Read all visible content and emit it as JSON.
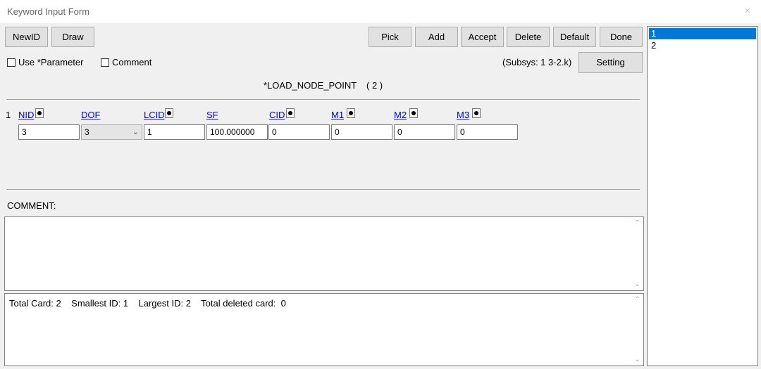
{
  "window": {
    "title": "Keyword Input Form",
    "close_glyph": "×"
  },
  "toolbar": {
    "left_buttons": [
      "NewID",
      "Draw"
    ],
    "right_buttons": [
      "Pick",
      "Add",
      "Accept",
      "Delete",
      "Default",
      "Done"
    ]
  },
  "options": {
    "use_parameter_label": "Use *Parameter",
    "use_parameter_checked": false,
    "comment_label": "Comment",
    "comment_checked": false,
    "subsys_text": "(Subsys: 1 3-2.k)",
    "setting_label": "Setting"
  },
  "keyword": {
    "title": "*LOAD_NODE_POINT",
    "count": "( 2 )"
  },
  "card": {
    "row_number": "1",
    "fields": [
      {
        "label": "NID",
        "value": "3",
        "has_pick": true,
        "kind": "input"
      },
      {
        "label": "DOF",
        "value": "3",
        "has_pick": false,
        "kind": "select"
      },
      {
        "label": "LCID",
        "value": "1",
        "has_pick": true,
        "kind": "input"
      },
      {
        "label": "SF",
        "value": "100.000000",
        "has_pick": false,
        "kind": "input"
      },
      {
        "label": "CID",
        "value": "0",
        "has_pick": true,
        "kind": "input"
      },
      {
        "label": "M1",
        "value": "0",
        "has_pick": true,
        "kind": "input"
      },
      {
        "label": "M2",
        "value": "0",
        "has_pick": true,
        "kind": "input"
      },
      {
        "label": "M3",
        "value": "0",
        "has_pick": true,
        "kind": "input"
      }
    ]
  },
  "comment": {
    "label": "COMMENT:",
    "text": ""
  },
  "status": {
    "text": "Total Card: 2    Smallest ID: 1    Largest ID: 2    Total deleted card:  0"
  },
  "id_list": {
    "items": [
      "1",
      "2"
    ],
    "selected": "1"
  },
  "colors": {
    "selection": "#0078d7",
    "link": "#0000ee",
    "button_face": "#e1e1e1",
    "window_bg": "#f0f0f0"
  }
}
